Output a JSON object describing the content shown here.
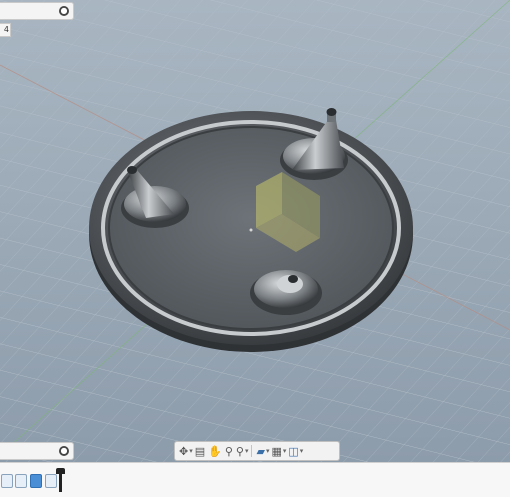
{
  "panels": {
    "top_small_label": "4"
  },
  "nav_toolbar": {
    "buttons": [
      {
        "name": "orbit-icon"
      },
      {
        "name": "look-at-icon"
      },
      {
        "name": "pan-icon"
      },
      {
        "name": "zoom-icon"
      },
      {
        "name": "zoom-window-icon"
      },
      {
        "name": "display-settings-icon"
      },
      {
        "name": "grid-settings-icon"
      },
      {
        "name": "viewports-icon"
      }
    ]
  },
  "timeline": {
    "items": 4,
    "active_index": 2
  },
  "colors": {
    "viewport_bg": "#9aa9b6",
    "model_body": "#5b5f63",
    "accent": "#4a8fd6"
  }
}
